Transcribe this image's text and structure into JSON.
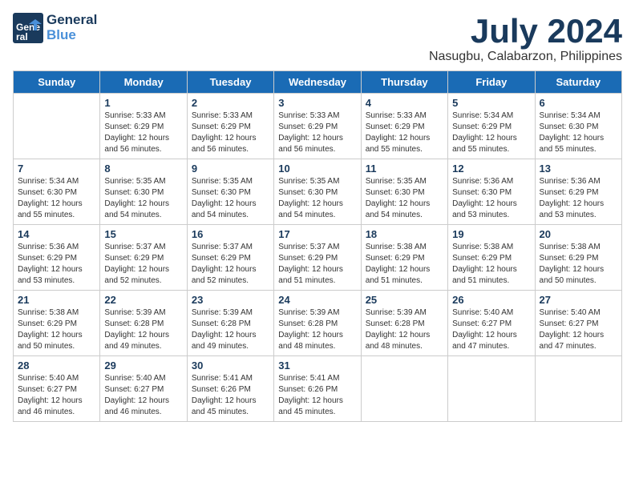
{
  "header": {
    "logo_line1": "General",
    "logo_line2": "Blue",
    "month_title": "July 2024",
    "location": "Nasugbu, Calabarzon, Philippines"
  },
  "weekdays": [
    "Sunday",
    "Monday",
    "Tuesday",
    "Wednesday",
    "Thursday",
    "Friday",
    "Saturday"
  ],
  "weeks": [
    [
      {
        "day": "",
        "info": ""
      },
      {
        "day": "1",
        "info": "Sunrise: 5:33 AM\nSunset: 6:29 PM\nDaylight: 12 hours\nand 56 minutes."
      },
      {
        "day": "2",
        "info": "Sunrise: 5:33 AM\nSunset: 6:29 PM\nDaylight: 12 hours\nand 56 minutes."
      },
      {
        "day": "3",
        "info": "Sunrise: 5:33 AM\nSunset: 6:29 PM\nDaylight: 12 hours\nand 56 minutes."
      },
      {
        "day": "4",
        "info": "Sunrise: 5:33 AM\nSunset: 6:29 PM\nDaylight: 12 hours\nand 55 minutes."
      },
      {
        "day": "5",
        "info": "Sunrise: 5:34 AM\nSunset: 6:29 PM\nDaylight: 12 hours\nand 55 minutes."
      },
      {
        "day": "6",
        "info": "Sunrise: 5:34 AM\nSunset: 6:30 PM\nDaylight: 12 hours\nand 55 minutes."
      }
    ],
    [
      {
        "day": "7",
        "info": "Sunrise: 5:34 AM\nSunset: 6:30 PM\nDaylight: 12 hours\nand 55 minutes."
      },
      {
        "day": "8",
        "info": "Sunrise: 5:35 AM\nSunset: 6:30 PM\nDaylight: 12 hours\nand 54 minutes."
      },
      {
        "day": "9",
        "info": "Sunrise: 5:35 AM\nSunset: 6:30 PM\nDaylight: 12 hours\nand 54 minutes."
      },
      {
        "day": "10",
        "info": "Sunrise: 5:35 AM\nSunset: 6:30 PM\nDaylight: 12 hours\nand 54 minutes."
      },
      {
        "day": "11",
        "info": "Sunrise: 5:35 AM\nSunset: 6:30 PM\nDaylight: 12 hours\nand 54 minutes."
      },
      {
        "day": "12",
        "info": "Sunrise: 5:36 AM\nSunset: 6:30 PM\nDaylight: 12 hours\nand 53 minutes."
      },
      {
        "day": "13",
        "info": "Sunrise: 5:36 AM\nSunset: 6:29 PM\nDaylight: 12 hours\nand 53 minutes."
      }
    ],
    [
      {
        "day": "14",
        "info": "Sunrise: 5:36 AM\nSunset: 6:29 PM\nDaylight: 12 hours\nand 53 minutes."
      },
      {
        "day": "15",
        "info": "Sunrise: 5:37 AM\nSunset: 6:29 PM\nDaylight: 12 hours\nand 52 minutes."
      },
      {
        "day": "16",
        "info": "Sunrise: 5:37 AM\nSunset: 6:29 PM\nDaylight: 12 hours\nand 52 minutes."
      },
      {
        "day": "17",
        "info": "Sunrise: 5:37 AM\nSunset: 6:29 PM\nDaylight: 12 hours\nand 51 minutes."
      },
      {
        "day": "18",
        "info": "Sunrise: 5:38 AM\nSunset: 6:29 PM\nDaylight: 12 hours\nand 51 minutes."
      },
      {
        "day": "19",
        "info": "Sunrise: 5:38 AM\nSunset: 6:29 PM\nDaylight: 12 hours\nand 51 minutes."
      },
      {
        "day": "20",
        "info": "Sunrise: 5:38 AM\nSunset: 6:29 PM\nDaylight: 12 hours\nand 50 minutes."
      }
    ],
    [
      {
        "day": "21",
        "info": "Sunrise: 5:38 AM\nSunset: 6:29 PM\nDaylight: 12 hours\nand 50 minutes."
      },
      {
        "day": "22",
        "info": "Sunrise: 5:39 AM\nSunset: 6:28 PM\nDaylight: 12 hours\nand 49 minutes."
      },
      {
        "day": "23",
        "info": "Sunrise: 5:39 AM\nSunset: 6:28 PM\nDaylight: 12 hours\nand 49 minutes."
      },
      {
        "day": "24",
        "info": "Sunrise: 5:39 AM\nSunset: 6:28 PM\nDaylight: 12 hours\nand 48 minutes."
      },
      {
        "day": "25",
        "info": "Sunrise: 5:39 AM\nSunset: 6:28 PM\nDaylight: 12 hours\nand 48 minutes."
      },
      {
        "day": "26",
        "info": "Sunrise: 5:40 AM\nSunset: 6:27 PM\nDaylight: 12 hours\nand 47 minutes."
      },
      {
        "day": "27",
        "info": "Sunrise: 5:40 AM\nSunset: 6:27 PM\nDaylight: 12 hours\nand 47 minutes."
      }
    ],
    [
      {
        "day": "28",
        "info": "Sunrise: 5:40 AM\nSunset: 6:27 PM\nDaylight: 12 hours\nand 46 minutes."
      },
      {
        "day": "29",
        "info": "Sunrise: 5:40 AM\nSunset: 6:27 PM\nDaylight: 12 hours\nand 46 minutes."
      },
      {
        "day": "30",
        "info": "Sunrise: 5:41 AM\nSunset: 6:26 PM\nDaylight: 12 hours\nand 45 minutes."
      },
      {
        "day": "31",
        "info": "Sunrise: 5:41 AM\nSunset: 6:26 PM\nDaylight: 12 hours\nand 45 minutes."
      },
      {
        "day": "",
        "info": ""
      },
      {
        "day": "",
        "info": ""
      },
      {
        "day": "",
        "info": ""
      }
    ]
  ]
}
